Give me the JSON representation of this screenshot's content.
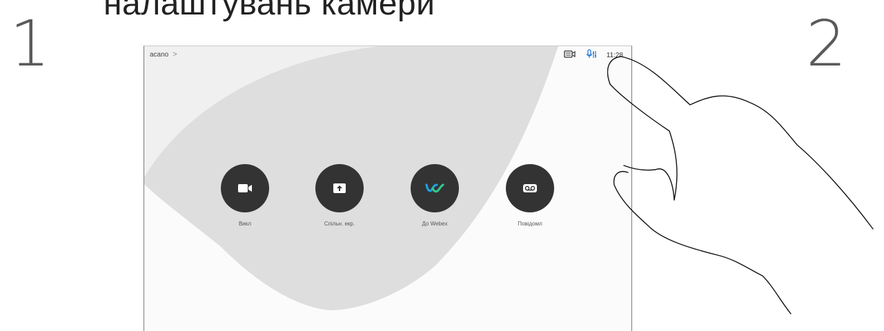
{
  "heading": "налаштувань камери",
  "steps": {
    "first": "1",
    "second": "2"
  },
  "screen": {
    "system_name": "acano",
    "chevron": ">",
    "clock": "11:28",
    "icons": {
      "camera_status": "camera-status-icon",
      "mic_status": "microphone-settings-icon"
    }
  },
  "actions": [
    {
      "label": "Викл",
      "icon": "video-camera-icon"
    },
    {
      "label": "Спільн. екр.",
      "icon": "share-screen-icon"
    },
    {
      "label": "До Webex",
      "icon": "webex-logo-icon"
    },
    {
      "label": "Повідомл",
      "icon": "voicemail-icon"
    }
  ],
  "colors": {
    "button": "#333333",
    "accent_blue": "#2a7ad0",
    "webex_blue": "#1ba0e1",
    "webex_green": "#38c58a"
  }
}
